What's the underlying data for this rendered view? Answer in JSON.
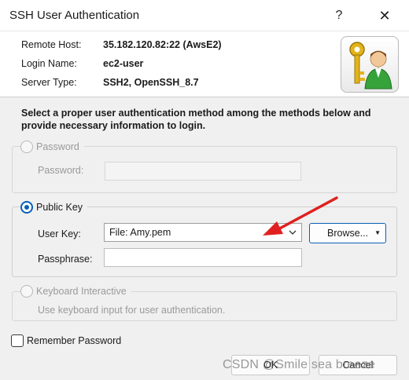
{
  "window": {
    "title": "SSH User Authentication",
    "help_glyph": "?",
    "close_glyph": "✕"
  },
  "info": {
    "remote_host_label": "Remote Host:",
    "remote_host_value": "35.182.120.82:22 (AwsE2)",
    "login_name_label": "Login Name:",
    "login_name_value": "ec2-user",
    "server_type_label": "Server Type:",
    "server_type_value": "SSH2, OpenSSH_8.7"
  },
  "instructions": "Select a proper user authentication method among the methods below and provide necessary information to login.",
  "password_group": {
    "label": "Password",
    "field_label": "Password:",
    "value": ""
  },
  "public_key_group": {
    "label": "Public Key",
    "user_key_label": "User Key:",
    "user_key_value": "File: Amy.pem",
    "browse_label": "Browse...",
    "passphrase_label": "Passphrase:",
    "passphrase_value": ""
  },
  "keyboard_group": {
    "label": "Keyboard Interactive",
    "hint": "Use keyboard input for user authentication."
  },
  "remember": {
    "label": "Remember Password"
  },
  "buttons": {
    "ok": "OK",
    "cancel": "Cancel"
  },
  "watermark": "CSDN @Smile sea breeze",
  "colors": {
    "accent": "#0a5fb8",
    "annotation_arrow": "#e02020"
  }
}
